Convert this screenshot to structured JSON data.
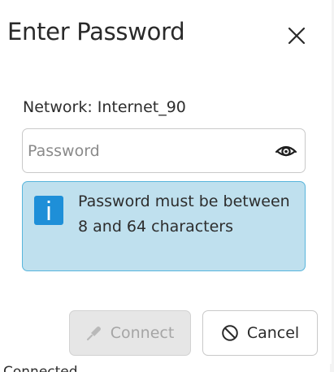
{
  "dialog": {
    "title": "Enter Password",
    "close_icon": "close-icon",
    "network_label": "Network: Internet_90",
    "password": {
      "value": "",
      "placeholder": "Password",
      "reveal_icon": "eye-icon"
    },
    "info": {
      "icon": "info-icon",
      "message": "Password must be between 8 and 64 characters"
    },
    "buttons": {
      "connect_label": "Connect",
      "connect_icon": "plug-icon",
      "connect_enabled": false,
      "cancel_label": "Cancel",
      "cancel_icon": "cancel-circle-icon"
    }
  },
  "background": {
    "status_text": "Connected"
  },
  "colors": {
    "info_background": "#bfe0ee",
    "info_border": "#58b5dc",
    "info_icon": "#1e8fd8",
    "disabled_button": "#e6e6e6"
  }
}
